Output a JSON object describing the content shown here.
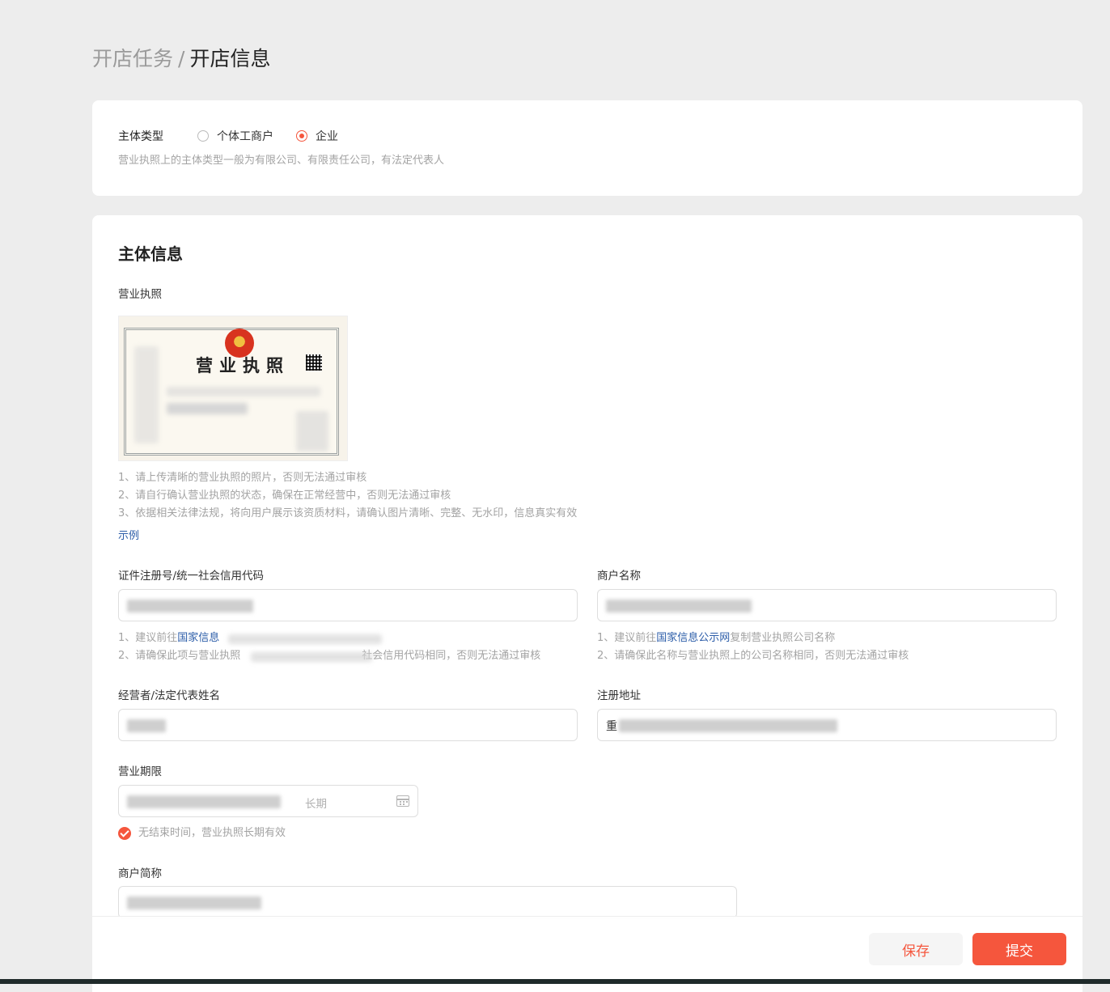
{
  "breadcrumb": {
    "parent": "开店任务",
    "separator": "/",
    "current": "开店信息"
  },
  "entity_type": {
    "label": "主体类型",
    "options": [
      "个体工商户",
      "企业"
    ],
    "selected": "企业",
    "hint": "营业执照上的主体类型一般为有限公司、有限责任公司，有法定代表人"
  },
  "subject_info": {
    "title": "主体信息",
    "license_label": "营业执照",
    "license_image_title": "营业执照",
    "license_hints": [
      "1、请上传清晰的营业执照的照片，否则无法通过审核",
      "2、请自行确认营业执照的状态，确保在正常经营中，否则无法通过审核",
      "3、依据相关法律法规，将向用户展示该资质材料，请确认图片清晰、完整、无水印，信息真实有效"
    ],
    "example_link": "示例",
    "reg_code_label": "证件注册号/统一社会信用代码",
    "reg_code_hint1_prefix": "1、建议前往",
    "reg_code_hint1_link": "国家信息",
    "reg_code_hint2_prefix": "2、请确保此项与营业执照",
    "reg_code_hint2_suffix": "社会信用代码相同，否则无法通过审核",
    "merchant_name_label": "商户名称",
    "merchant_hint1_prefix": "1、建议前往",
    "merchant_hint1_link": "国家信息公示网",
    "merchant_hint1_suffix": "复制营业执照公司名称",
    "merchant_hint2": "2、请确保此名称与营业执照上的公司名称相同，否则无法通过审核",
    "legal_rep_label": "经营者/法定代表姓名",
    "address_label": "注册地址",
    "address_value_visible": "重",
    "term_label": "营业期限",
    "term_end_placeholder": "长期",
    "long_term_checkbox": "无结束时间，营业执照长期有效",
    "short_name_label": "商户简称"
  },
  "footer": {
    "save": "保存",
    "submit": "提交"
  }
}
